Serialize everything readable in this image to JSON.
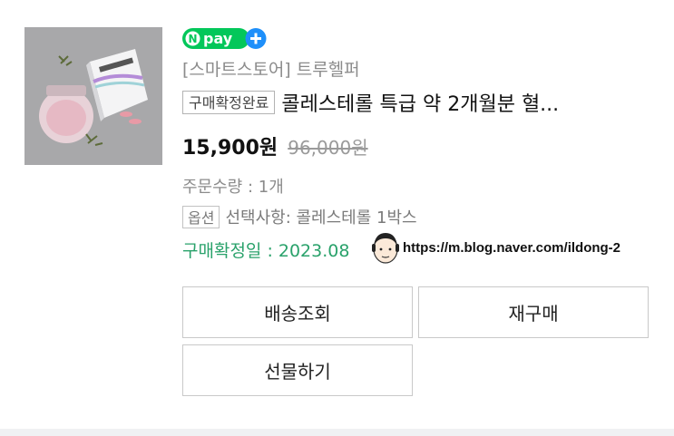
{
  "product": {
    "thumbnail_icon": "supplement-product-image",
    "npay_badge_icon": "naver-pay-plus-logo",
    "npay_text": "pay",
    "store_name": "[스마트스토어] 트루헬퍼",
    "status_badge": "구매확정완료",
    "title": "콜레스테롤 특급 약 2개월분 혈...",
    "price": "15,900원",
    "original_price": "96,000원",
    "quantity": "주문수량 : 1개",
    "option_badge": "옵션",
    "option_text": "선택사항: 콜레스테롤 1박스",
    "confirm_date": "구매확정일 : 2023.08"
  },
  "watermark": {
    "icon": "cartoon-face-icon",
    "text": "https://m.blog.naver.com/ildong-2"
  },
  "actions": {
    "delivery_label": "배송조회",
    "rebuy_label": "재구매",
    "gift_label": "선물하기"
  },
  "colors": {
    "npay_green": "#03c75a",
    "npay_blue": "#1e8ffa",
    "confirm_green": "#2aa26b",
    "muted_text": "#8b8b8b"
  }
}
